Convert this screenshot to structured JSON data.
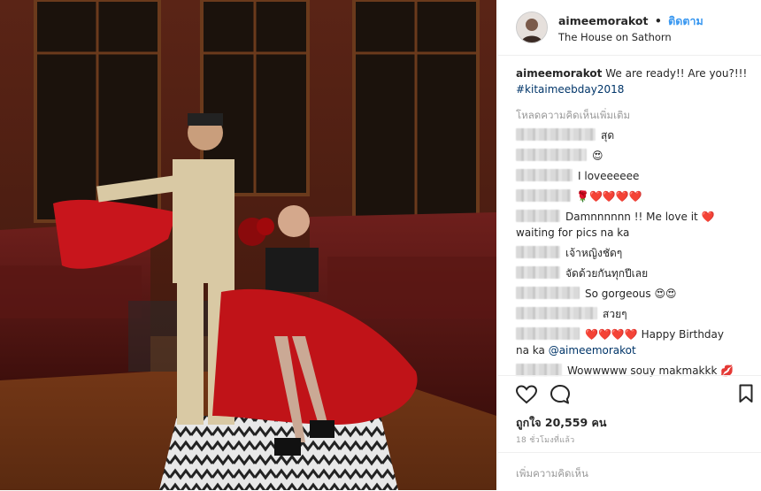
{
  "post": {
    "username": "aimeemorakot",
    "separator": "•",
    "follow_label": "ติดตาม",
    "location": "The House on Sathorn"
  },
  "caption": {
    "username": "aimeemorakot",
    "text": "We are ready!! Are you?!!!",
    "hashtag": "#kitaimeebday2018"
  },
  "load_more_label": "โหลดความคิดเห็นเพิ่มเติม",
  "comments": [
    {
      "text": "สุด"
    },
    {
      "text": "😍"
    },
    {
      "text": "I loveeeeee"
    },
    {
      "text": "🌹❤️❤️❤️❤️"
    },
    {
      "text": "Damnnnnnn !! Me love it ❤️"
    },
    {
      "text": "waiting for pics na ka"
    },
    {
      "text": "เจ้าหญิงชัดๆ"
    },
    {
      "text": "จัดด้วยกันทุกปีเลย"
    },
    {
      "text": "So gorgeous 😍😍"
    },
    {
      "text": "สวยๆ"
    },
    {
      "text": "❤️❤️❤️❤️ Happy Birthday"
    },
    {
      "text": "na ka",
      "mention": "@aimeemorakot"
    },
    {
      "text": "Wowwwww souy makmakkk 💋"
    }
  ],
  "likes_label": "ถูกใจ 20,559 คน",
  "timestamp": "18 ชั่วโมงที่แล้ว",
  "add_comment_placeholder": "เพิ่มความคิดเห็น",
  "icons": {
    "like": "heart-outline-icon",
    "comment": "comment-bubble-icon",
    "save": "bookmark-icon"
  },
  "colors": {
    "link_blue": "#3897f0",
    "hashtag": "#003569",
    "muted": "#999999",
    "border": "#efefef"
  }
}
